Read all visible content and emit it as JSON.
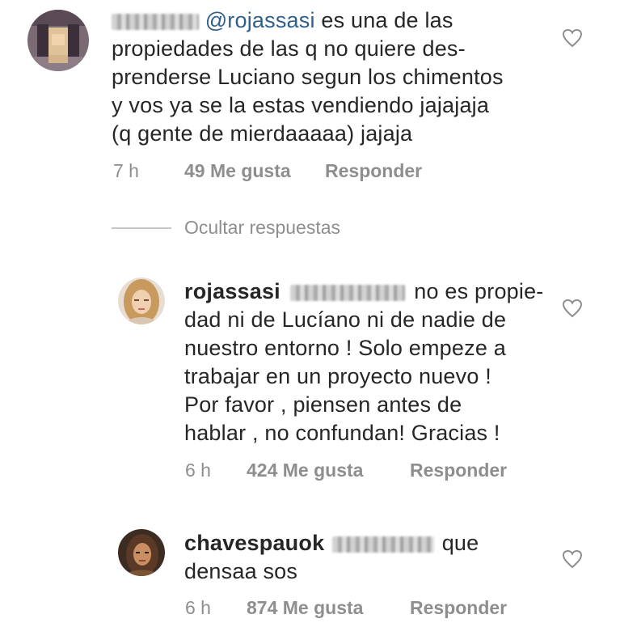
{
  "comments": [
    {
      "username": "",
      "text": "@rojassasi es una de las propiedades de las q no quiere desprenderse Luciano segun los chimentos y vos ya se la estas vendiendo jajajaja (q gente de mierdaaaaa) jajaja",
      "mention": "@rojassasi",
      "lines": [
        "es una de las",
        "propiedades de las q no quiere des-",
        "prenderse Luciano segun los chimentos",
        "y vos ya se la estas vendiendo jajajaja",
        "(q gente de mierdaaaaa) jajaja"
      ],
      "time": "7 h",
      "likes": "49 Me gusta",
      "reply": "Responder",
      "avatar": "pixelated-avatar-icon"
    },
    {
      "username": "rojassasi",
      "lines": [
        "no es propie-",
        "dad ni de Lucíano ni de nadie de",
        "nuestro entorno ! Solo empeze a",
        "trabajar en un proyecto nuevo !",
        "Por favor , piensen antes de",
        "hablar , no confundan! Gracias !"
      ],
      "time": "6 h",
      "likes": "424 Me gusta",
      "reply": "Responder",
      "avatar": "woman-blonde-avatar-icon"
    },
    {
      "username": "chavespauok",
      "lines": [
        "que",
        "densaa sos"
      ],
      "time": "6 h",
      "likes": "874 Me gusta",
      "reply": "Responder",
      "avatar": "woman-dark-avatar-icon"
    }
  ],
  "hide_replies": "Ocultar respuestas",
  "colors": {
    "text": "#262626",
    "meta": "#8e8e8e",
    "mention": "#2f5f8f"
  }
}
